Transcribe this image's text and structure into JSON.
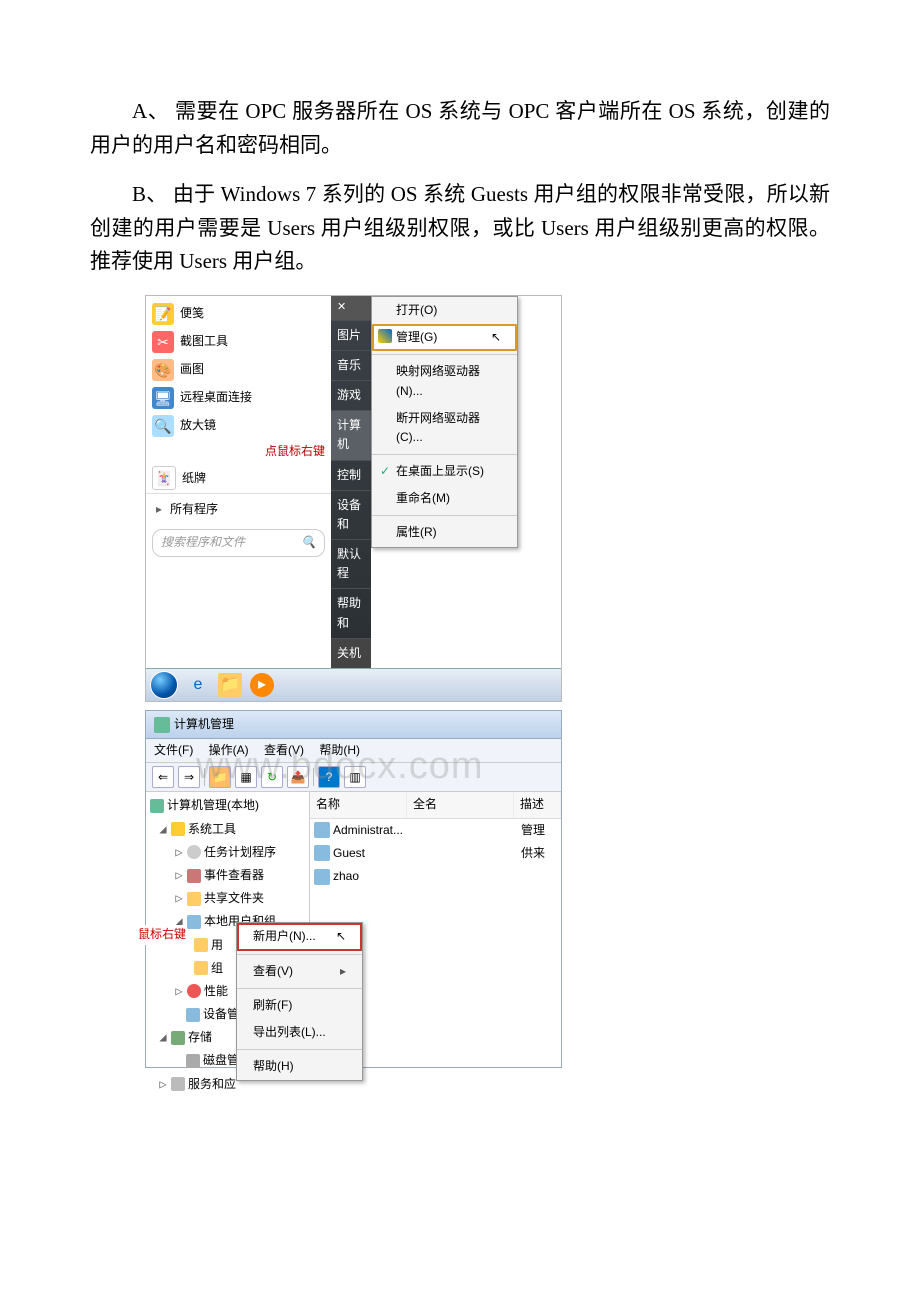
{
  "paragraphA": "A、 需要在 OPC 服务器所在 OS 系统与 OPC 客户端所在 OS 系统，创建的用户的用户名和密码相同。",
  "paragraphB": "B、 由于 Windows 7 系列的 OS 系统 Guests 用户组的权限非常受限，所以新创建的用户需要是 Users 用户组级别权限，或比 Users 用户组级别更高的权限。推荐使用 Users 用户组。",
  "watermark": "www.bdocx.com",
  "fig1": {
    "startItems": [
      "便笺",
      "截图工具",
      "画图",
      "远程桌面连接",
      "放大镜",
      "纸牌"
    ],
    "rightClickHint": "点鼠标右键",
    "allPrograms": "所有程序",
    "searchPlaceholder": "搜索程序和文件",
    "darkItems": [
      "图片",
      "音乐",
      "游戏",
      "计算机",
      "控制",
      "设备和",
      "默认程",
      "帮助和"
    ],
    "closeLabel": "关机",
    "ctx": {
      "open": "打开(O)",
      "manage": "管理(G)",
      "map": "映射网络驱动器(N)...",
      "disconnect": "断开网络驱动器(C)...",
      "showDesktop": "在桌面上显示(S)",
      "rename": "重命名(M)",
      "properties": "属性(R)"
    }
  },
  "fig2": {
    "title": "计算机管理",
    "menus": [
      "文件(F)",
      "操作(A)",
      "查看(V)",
      "帮助(H)"
    ],
    "cols": {
      "name": "名称",
      "full": "全名",
      "desc": "描述"
    },
    "users": [
      {
        "n": "Administrat...",
        "d": "管理"
      },
      {
        "n": "Guest",
        "d": "供来"
      },
      {
        "n": "zhao",
        "d": ""
      }
    ],
    "tree": {
      "root": "计算机管理(本地)",
      "sys": "系统工具",
      "task": "任务计划程序",
      "event": "事件查看器",
      "share": "共享文件夹",
      "local": "本地用户和组",
      "users": "用",
      "groups": "组",
      "perf": "性能",
      "dev": "设备管",
      "store": "存储",
      "disk": "磁盘管",
      "svc": "服务和应"
    },
    "redHint": "鼠标右键",
    "ctx": {
      "newUser": "新用户(N)...",
      "view": "查看(V)",
      "refresh": "刷新(F)",
      "export": "导出列表(L)...",
      "help": "帮助(H)"
    }
  }
}
